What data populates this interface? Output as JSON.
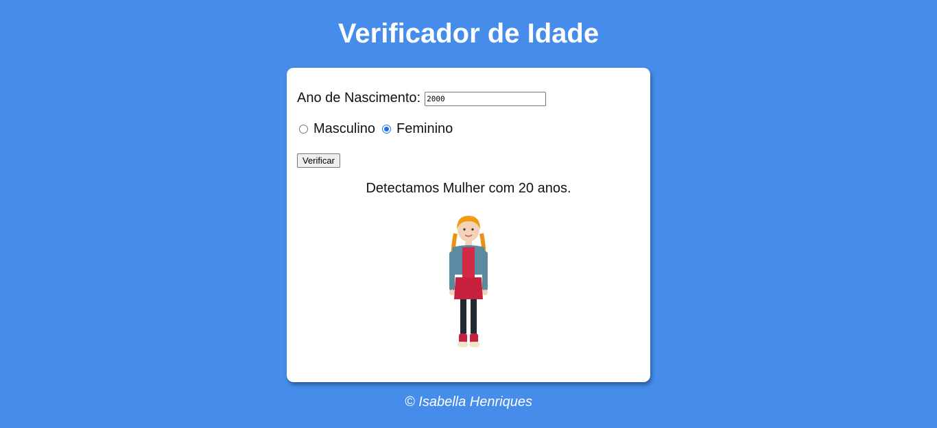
{
  "header": {
    "title": "Verificador de Idade"
  },
  "form": {
    "year_label": "Ano de Nascimento:",
    "year_value": "2000",
    "sex_options": [
      {
        "label": "Masculino",
        "checked": false
      },
      {
        "label": "Feminino",
        "checked": true
      }
    ],
    "verify_label": "Verificar"
  },
  "result": {
    "text": "Detectamos Mulher com 20 anos.",
    "image": "girl-illustration"
  },
  "footer": {
    "text": "© Isabella Henriques"
  },
  "colors": {
    "background": "#458ceb",
    "card": "#ffffff",
    "radio_accent": "#1a73e8"
  }
}
